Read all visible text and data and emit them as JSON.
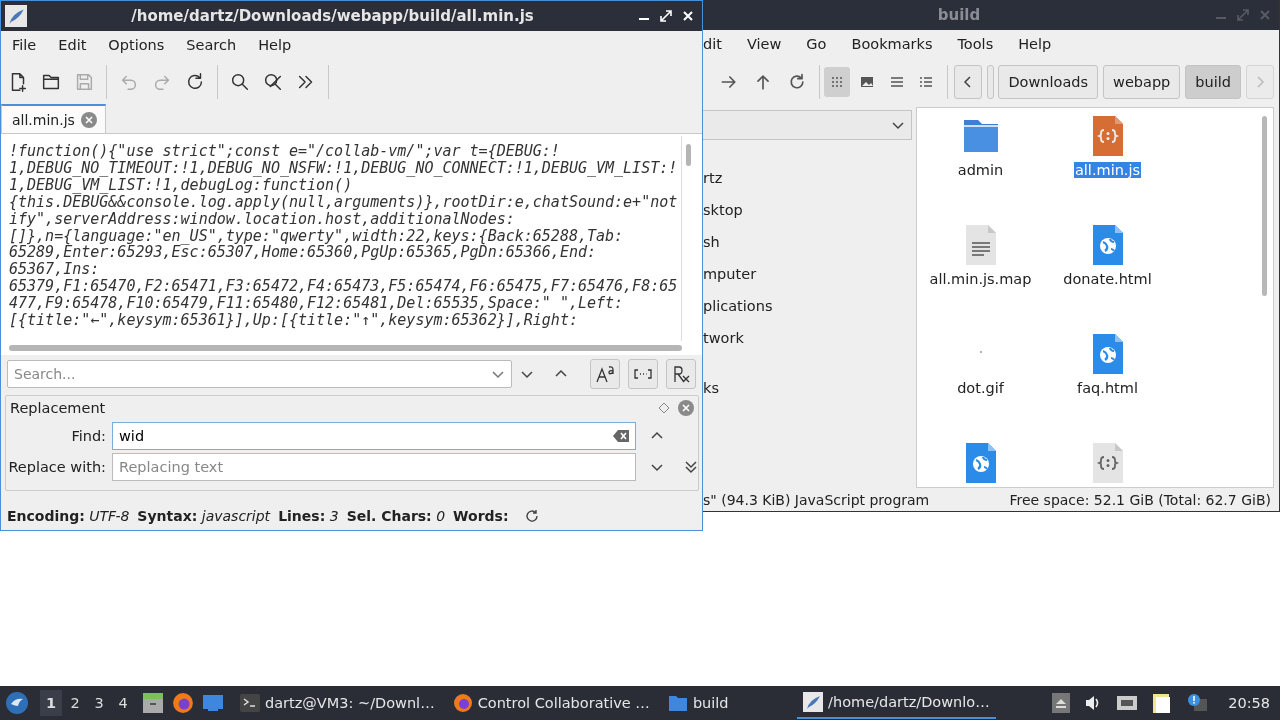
{
  "editor": {
    "title": "/home/dartz/Downloads/webapp/build/all.min.js",
    "menu": [
      "File",
      "Edit",
      "Options",
      "Search",
      "Help"
    ],
    "toolbar": [
      {
        "kind": "new",
        "disabled": false
      },
      {
        "kind": "open",
        "disabled": false
      },
      {
        "kind": "save",
        "disabled": true
      },
      {
        "kind": "sep"
      },
      {
        "kind": "undo",
        "disabled": true
      },
      {
        "kind": "redo",
        "disabled": true
      },
      {
        "kind": "reload",
        "disabled": false
      },
      {
        "kind": "sep"
      },
      {
        "kind": "search",
        "disabled": false
      },
      {
        "kind": "replace",
        "disabled": false
      },
      {
        "kind": "more",
        "disabled": false
      },
      {
        "kind": "sep"
      }
    ],
    "tabs": [
      {
        "label": "all.min.js",
        "selected": true
      }
    ],
    "code_lines": [
      "!function(){\"use strict\";const e=\"/collab-vm/\";var t={DEBUG:!",
      "1,DEBUG_NO_TIMEOUT:!1,DEBUG_NO_NSFW:!1,DEBUG_NO_CONNECT:!1,DEBUG_VM_LIST:!",
      "1,DEBUG_VM_LIST:!1,debugLog:function()",
      "{this.DEBUG&&console.log.apply(null,arguments)},rootDir:e,chatSound:e+\"not",
      "ify\",serverAddress:window.location.host,additionalNodes:",
      "[]},n={language:\"en_US\",type:\"qwerty\",width:22,keys:{Back:65288,Tab:",
      "65289,Enter:65293,Esc:65307,Home:65360,PgUp:65365,PgDn:65366,End:",
      "65367,Ins:",
      "65379,F1:65470,F2:65471,F3:65472,F4:65473,F5:65474,F6:65475,F7:65476,F8:65",
      "477,F9:65478,F10:65479,F11:65480,F12:65481,Del:65535,Space:\" \",Left:",
      "[{title:\"←\",keysym:65361}],Up:[{title:\"↑\",keysym:65362}],Right:"
    ],
    "search": {
      "placeholder": "Search..."
    },
    "replacement": {
      "title": "Replacement",
      "find_label": "Find:",
      "find_value": "wid",
      "replace_label": "Replace with:",
      "replace_placeholder": "Replacing text"
    },
    "status": [
      {
        "label": "Encoding:",
        "value": "UTF-8"
      },
      {
        "label": "Syntax:",
        "value": "javascript"
      },
      {
        "label": "Lines:",
        "value": "3"
      },
      {
        "label": "Sel. Chars:",
        "value": "0"
      },
      {
        "label": "Words:"
      }
    ]
  },
  "file_manager": {
    "title": "build",
    "menu": [
      "dit",
      "View",
      "Go",
      "Bookmarks",
      "Tools",
      "Help"
    ],
    "view_modes": [
      {
        "kind": "icons",
        "selected": true
      },
      {
        "kind": "thumbnails",
        "selected": false
      },
      {
        "kind": "compact",
        "selected": false
      },
      {
        "kind": "details",
        "selected": false
      }
    ],
    "path": [
      {
        "label": "Downloads",
        "selected": false
      },
      {
        "label": "webapp",
        "selected": false
      },
      {
        "label": "build",
        "selected": true
      }
    ],
    "sidebar_groups": [
      {
        "items": [
          "rtz",
          "sktop",
          "sh",
          "mputer",
          "plications",
          "twork"
        ]
      },
      {
        "items": [
          "ks"
        ]
      }
    ],
    "files": [
      {
        "name": "admin",
        "kind": "folder",
        "selected": false
      },
      {
        "name": "all.min.js",
        "kind": "script",
        "selected": true
      },
      {
        "name": "all.min.js.map",
        "kind": "text",
        "selected": false
      },
      {
        "name": "donate.html",
        "kind": "web",
        "selected": false
      },
      {
        "name": "dot.gif",
        "kind": "image",
        "selected": false
      },
      {
        "name": "faq.html",
        "kind": "web",
        "selected": false
      },
      {
        "kind": "web",
        "selected": false
      },
      {
        "kind": "plain-script",
        "selected": false
      }
    ],
    "status_left": "s\" (94.3 KiB) JavaScript program",
    "status_right": "Free space: 52.1 GiB (Total: 62.7 GiB)"
  },
  "taskbar": {
    "workspaces": [
      {
        "label": "1",
        "selected": true
      },
      {
        "label": "2",
        "selected": false
      },
      {
        "label": "3",
        "selected": false
      },
      {
        "label": "4",
        "selected": false
      }
    ],
    "tasks": [
      {
        "kind": "terminal",
        "label": "dartz@VM3: ~/Downl…",
        "selected": false
      },
      {
        "kind": "firefox",
        "label": "Control Collaborative …",
        "selected": false
      },
      {
        "kind": "folder",
        "label": "build",
        "selected": false
      },
      {
        "kind": "editor",
        "label": "/home/dartz/Downlo…",
        "selected": true
      }
    ],
    "clock": "20:58"
  }
}
